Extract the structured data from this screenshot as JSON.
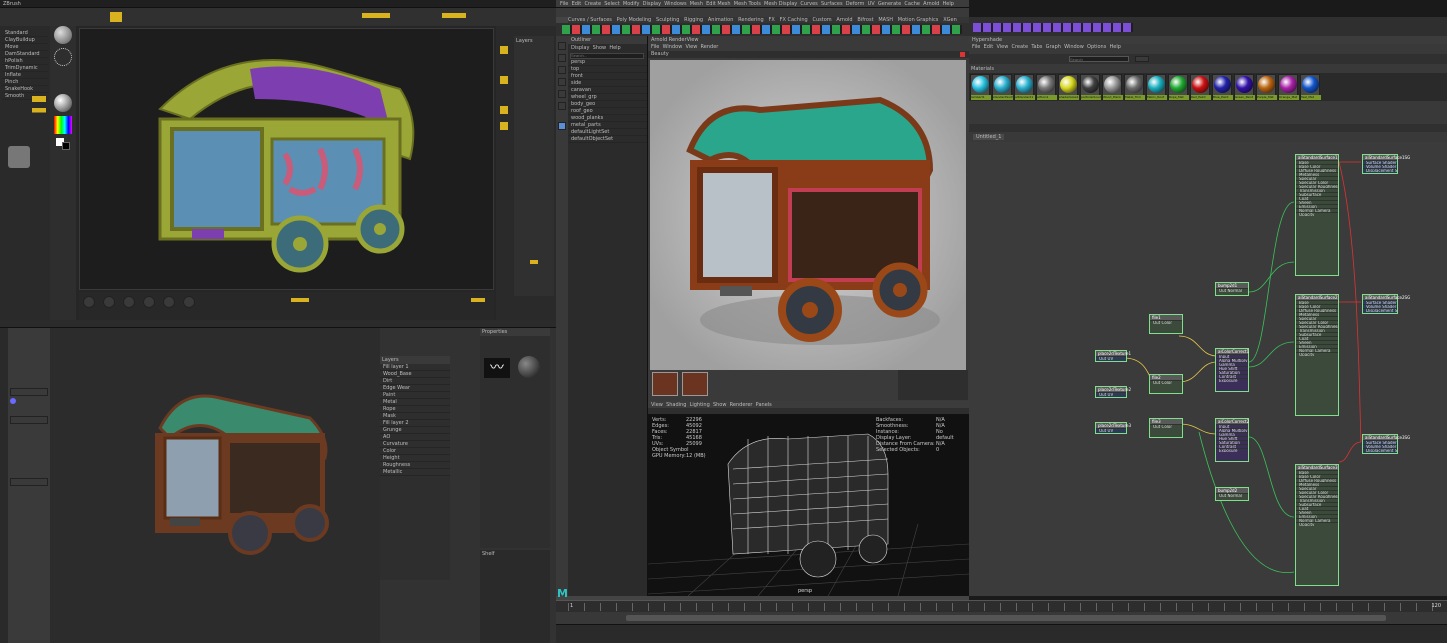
{
  "zbrush": {
    "menu_text": "ZBrush",
    "layers_title": "Layers",
    "tools": [
      "Standard",
      "ClayBuildup",
      "Move",
      "DamStandard",
      "hPolish",
      "TrimDynamic",
      "Inflate",
      "Pinch",
      "SnakeHook",
      "Smooth"
    ],
    "buttons": {
      "draw": "Draw",
      "move": "Move",
      "scale": "Scale",
      "rotate": "Rotate"
    }
  },
  "maya": {
    "menu_items": [
      "File",
      "Edit",
      "Create",
      "Select",
      "Modify",
      "Display",
      "Windows",
      "Mesh",
      "Edit Mesh",
      "Mesh Tools",
      "Mesh Display",
      "Curves",
      "Surfaces",
      "Deform",
      "UV",
      "Generate",
      "Cache",
      "Arnold",
      "Help"
    ],
    "shelf_tabs": [
      "Curves / Surfaces",
      "Poly Modeling",
      "Sculpting",
      "Rigging",
      "Animation",
      "Rendering",
      "FX",
      "FX Caching",
      "Custom",
      "Arnold",
      "Bifrost",
      "MASH",
      "Motion Graphics",
      "XGen"
    ],
    "outliner_title": "Outliner",
    "outliner_menu": [
      "Display",
      "Show",
      "Help"
    ],
    "outliner_search": "Search...",
    "outliner_items": [
      "persp",
      "top",
      "front",
      "side",
      "caravan",
      "wheel_grp",
      "body_geo",
      "roof_geo",
      "wood_planks",
      "metal_parts",
      "defaultLightSet",
      "defaultObjectSet"
    ],
    "render_view_title": "Arnold RenderView",
    "render_view_menu": [
      "File",
      "Window",
      "View",
      "Render"
    ],
    "render_camera": "Beauty",
    "viewport_menu": [
      "View",
      "Shading",
      "Lighting",
      "Show",
      "Renderer",
      "Panels"
    ],
    "hud_left_labels": [
      "Verts:",
      "Edges:",
      "Faces:",
      "Tris:",
      "UVs:",
      "Object Symbol",
      "GPU Memory:"
    ],
    "hud_left_values": [
      "22296",
      "45092",
      "22817",
      "45168",
      "25099",
      "",
      "12 (MB)"
    ],
    "hud_right_labels": [
      "Backfaces:",
      "Smoothness:",
      "Instance:",
      "Display Layer:",
      "Distance From Camera:",
      "Selected Objects:"
    ],
    "hud_right_values": [
      "N/A",
      "N/A",
      "No",
      "default",
      "N/A",
      "0"
    ],
    "viewport_camera": "persp",
    "timeline_start": "1",
    "timeline_end": "120",
    "logo": "M"
  },
  "hypershade": {
    "title": "Hypershade",
    "menu": [
      "File",
      "Edit",
      "View",
      "Create",
      "Tabs",
      "Graph",
      "Window",
      "Options",
      "Help"
    ],
    "browser_label": "Materials",
    "materials": [
      "lambert1",
      "standardSurface1",
      "aiStandard1",
      "aiToon1",
      "shaderGlow1",
      "particleCloud1",
      "Wood_Plank",
      "Metal_Trim",
      "Fabric_Roof",
      "Rope_Mat",
      "Red_Paint",
      "Blue_Paint",
      "Green_Paint",
      "Purple_Mat",
      "Orange_Mat",
      "Teal_Mat"
    ],
    "swatch_colors": [
      "#2bc3e0",
      "#2bb0d0",
      "#2bb0d0",
      "#7a7a7a",
      "#d8d820",
      "#404040",
      "#9b9b9b",
      "#6e6e6e",
      "#1bb0c0",
      "#22aa33",
      "#cc1111",
      "#2222aa",
      "#3311aa",
      "#bb6611",
      "#aa22aa",
      "#1155cc"
    ],
    "search_placeholder": "Search",
    "graph_tab": "Untitled_1",
    "nodes": [
      {
        "title": "aiStandardSurface1",
        "ports": [
          "Base",
          "Base Color",
          "Diffuse Roughness",
          "Metalness",
          "Specular",
          "Specular Color",
          "Specular Roughness",
          "Transmission",
          "Subsurface",
          "Coat",
          "Sheen",
          "Emission",
          "Normal Camera",
          "Opacity"
        ]
      },
      {
        "title": "aiStandardSurface2",
        "ports": [
          "Base",
          "Base Color",
          "Diffuse Roughness",
          "Metalness",
          "Specular",
          "Specular Color",
          "Specular Roughness",
          "Transmission",
          "Subsurface",
          "Coat",
          "Sheen",
          "Emission",
          "Normal Camera",
          "Opacity"
        ]
      },
      {
        "title": "aiStandardSurface3",
        "ports": [
          "Base",
          "Base Color",
          "Diffuse Roughness",
          "Metalness",
          "Specular",
          "Specular Color",
          "Specular Roughness",
          "Transmission",
          "Subsurface",
          "Coat",
          "Sheen",
          "Emission",
          "Normal Camera",
          "Opacity"
        ]
      },
      {
        "title": "aiStandardSurface1SG",
        "ports": [
          "Surface Shader",
          "Volume Shader",
          "Displacement Shader"
        ]
      },
      {
        "title": "aiStandardSurface2SG",
        "ports": [
          "Surface Shader",
          "Volume Shader",
          "Displacement Shader"
        ]
      },
      {
        "title": "aiStandardSurface3SG",
        "ports": [
          "Surface Shader",
          "Volume Shader",
          "Displacement Shader"
        ]
      },
      {
        "title": "aiColorCorrect1",
        "ports": [
          "Input",
          "Alpha Multiply",
          "Gamma",
          "Hue Shift",
          "Saturation",
          "Contrast",
          "Exposure"
        ]
      },
      {
        "title": "aiColorCorrect2",
        "ports": [
          "Input",
          "Alpha Multiply",
          "Gamma",
          "Hue Shift",
          "Saturation",
          "Contrast",
          "Exposure"
        ]
      },
      {
        "title": "file1",
        "ports": [
          "Out Color",
          "Out Alpha"
        ]
      },
      {
        "title": "file2",
        "ports": [
          "Out Color",
          "Out Alpha"
        ]
      },
      {
        "title": "file3",
        "ports": [
          "Out Color",
          "Out Alpha"
        ]
      },
      {
        "title": "place2dTexture1",
        "ports": [
          "Out UV"
        ]
      },
      {
        "title": "place2dTexture2",
        "ports": [
          "Out UV"
        ]
      },
      {
        "title": "place2dTexture3",
        "ports": [
          "Out UV"
        ]
      },
      {
        "title": "bump2d1",
        "ports": [
          "Bump Value",
          "Out Normal"
        ]
      },
      {
        "title": "bump2d2",
        "ports": [
          "Bump Value",
          "Out Normal"
        ]
      }
    ]
  },
  "painter": {
    "title": "Substance Painter",
    "layers_title": "Layers",
    "layers": [
      "Fill layer 1",
      "Wood_Base",
      "Dirt",
      "Edge Wear",
      "Paint",
      "Metal",
      "Rope",
      "Mask",
      "Fill layer 2",
      "Grunge",
      "AO",
      "Curvature",
      "Color",
      "Height",
      "Roughness",
      "Metallic"
    ],
    "properties_title": "Properties",
    "shelf_title": "Shelf"
  }
}
